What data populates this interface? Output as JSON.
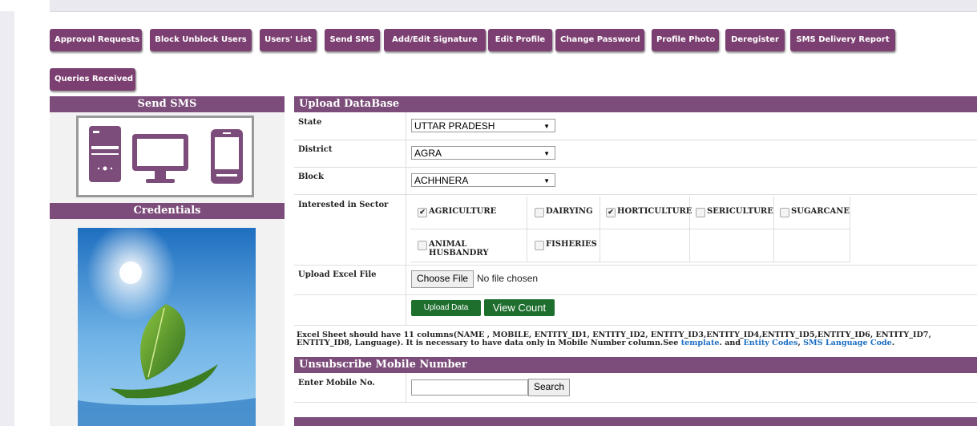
{
  "nav": {
    "buttons": [
      "Approval Requests",
      "Block Unblock Users",
      "Users' List",
      "Send SMS",
      "Add/Edit Signature",
      "Edit Profile",
      "Change Password",
      "Profile Photo",
      "Deregister",
      "SMS Delivery Report",
      "Queries Received"
    ]
  },
  "sidebar": {
    "send_sms_title": "Send SMS",
    "credentials_title": "Credentials"
  },
  "upload": {
    "title": "Upload DataBase",
    "state_label": "State",
    "state_value": "UTTAR PRADESH",
    "district_label": "District",
    "district_value": "AGRA",
    "block_label": "Block",
    "block_value": "ACHHNERA",
    "sector_label": "Interested in Sector",
    "sectors": [
      {
        "name": "AGRICULTURE",
        "checked": true
      },
      {
        "name": "DAIRYING",
        "checked": false
      },
      {
        "name": "HORTICULTURE",
        "checked": true
      },
      {
        "name": "SERICULTURE",
        "checked": false
      },
      {
        "name": "SUGARCANE",
        "checked": false
      },
      {
        "name": "ANIMAL HUSBANDRY",
        "checked": false
      },
      {
        "name": "FISHERIES",
        "checked": false
      }
    ],
    "excel_label": "Upload Excel File",
    "choose_file": "Choose File",
    "no_file": "No file chosen",
    "upload_btn": "Upload Data",
    "view_count_btn": "View Count",
    "note_text": "Excel Sheet should have 11 columns(NAME , MOBILE, ENTITY_ID1, ENTITY_ID2, ENTITY_ID3,ENTITY_ID4,ENTITY_ID5,ENTITY_ID6, ENTITY_ID7, ENTITY_ID8, Language). It is necessary to have data only in Mobile Number column.See",
    "note_template": "template",
    "note_and": ". and",
    "note_entity": "Entity Codes",
    "note_comma": ",",
    "note_lang": "SMS Language Code",
    "note_end": "."
  },
  "unsubscribe": {
    "title": "Unsubscribe Mobile Number",
    "mobile_label": "Enter Mobile No.",
    "mobile_value": "",
    "search_btn": "Search"
  },
  "colors": {
    "accent": "#7c4c7a",
    "nav": "#7c3f71",
    "green": "#1e6e2e",
    "link": "#1a6ec4"
  }
}
